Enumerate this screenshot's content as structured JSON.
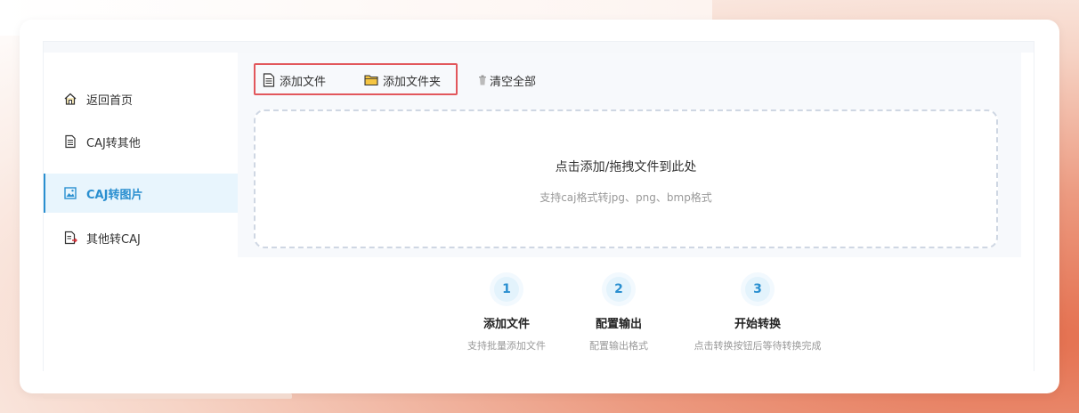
{
  "sidebar": {
    "items": [
      {
        "label": "返回首页",
        "icon": "home-icon",
        "active": false
      },
      {
        "label": "CAJ转其他",
        "icon": "document-icon",
        "active": false
      },
      {
        "label": "CAJ转图片",
        "icon": "image-icon",
        "active": true
      },
      {
        "label": "其他转CAJ",
        "icon": "document-convert-icon",
        "active": false
      }
    ]
  },
  "toolbar": {
    "add_file_label": "添加文件",
    "add_folder_label": "添加文件夹",
    "clear_all_label": "清空全部"
  },
  "dropzone": {
    "title": "点击添加/拖拽文件到此处",
    "subtitle": "支持caj格式转jpg、png、bmp格式"
  },
  "steps": [
    {
      "number": "1",
      "title": "添加文件",
      "subtitle": "支持批量添加文件"
    },
    {
      "number": "2",
      "title": "配置输出",
      "subtitle": "配置输出格式"
    },
    {
      "number": "3",
      "title": "开始转换",
      "subtitle": "点击转换按钮后等待转换完成"
    }
  ],
  "colors": {
    "accent": "#2a8fd0",
    "highlight_border": "#e2575c",
    "active_bg": "#e8f5fd"
  }
}
